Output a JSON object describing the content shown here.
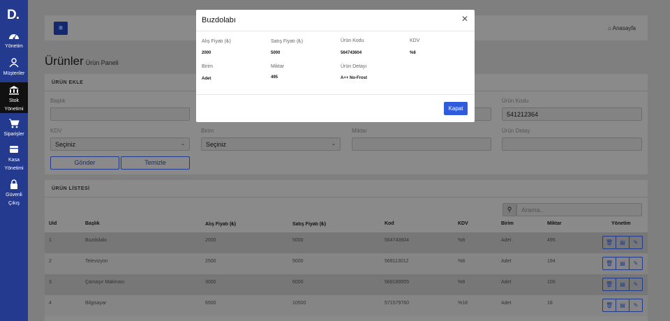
{
  "sidebar": {
    "logo": "D.",
    "items": [
      {
        "label_line1": "Yönetim",
        "label_line2": "",
        "icon": "dashboard-icon"
      },
      {
        "label_line1": "Müşteriler",
        "label_line2": "",
        "icon": "user-icon"
      },
      {
        "label_line1": "Stok",
        "label_line2": "Yönetimi",
        "icon": "bank-icon"
      },
      {
        "label_line1": "Siparişler",
        "label_line2": "",
        "icon": "cart-icon"
      },
      {
        "label_line1": "Kasa",
        "label_line2": "Yönetimi",
        "icon": "cash-register-icon"
      },
      {
        "label_line1": "Güvenli",
        "label_line2": "Çıkış",
        "icon": "lock-icon"
      }
    ]
  },
  "header": {
    "menu_icon": "≡",
    "home_label": "Anasayfa"
  },
  "page": {
    "title": "Ürünler",
    "subtitle": "Ürün Paneli"
  },
  "form": {
    "heading": "ÜRÜN EKLE",
    "baslik_label": "Başlık",
    "urun_kodu_label": "Ürün Kodu",
    "urun_kodu_value": "541212364",
    "kdv_label": "KDV",
    "kdv_value": "Seçiniz",
    "birim_label": "Birim",
    "birim_value": "Seçiniz",
    "miktar_label": "Miktar",
    "urun_detay_label": "Ürün Detay",
    "submit_label": "Gönder",
    "clear_label": "Temizle"
  },
  "list": {
    "heading": "ÜRÜN LİSTESİ",
    "search_placeholder": "Arama..",
    "columns": [
      "Uid",
      "Başlık",
      "Alış Fiyatı (₺)",
      "Satış Fiyatı (₺)",
      "Kod",
      "KDV",
      "Birim",
      "Miktar",
      "Yönetim"
    ],
    "rows": [
      {
        "uid": "1",
        "baslik": "Buzdolabı",
        "alis": "2000",
        "satis": "5000",
        "kod": "564743604",
        "kdv": "%8",
        "birim": "Adet",
        "miktar": "495"
      },
      {
        "uid": "2",
        "baslik": "Televizyon",
        "alis": "2500",
        "satis": "5000",
        "kod": "569113012",
        "kdv": "%8",
        "birim": "Adet",
        "miktar": "194"
      },
      {
        "uid": "3",
        "baslik": "Çamaşır Makinası",
        "alis": "3000",
        "satis": "6000",
        "kod": "569189555",
        "kdv": "%8",
        "birim": "Adet",
        "miktar": "100"
      },
      {
        "uid": "4",
        "baslik": "Bilgisayar",
        "alis": "6500",
        "satis": "10500",
        "kod": "571579760",
        "kdv": "%18",
        "birim": "Adet",
        "miktar": "18"
      }
    ]
  },
  "modal": {
    "title": "Buzdolabı",
    "alis_label": "Alış Fiyatı (₺)",
    "alis_value": "2000",
    "satis_label": "Satış Fiyatı (₺)",
    "satis_value": "5000",
    "kod_label": "Ürün Kodu",
    "kod_value": "564743604",
    "kdv_label": "KDV",
    "kdv_value": "%8",
    "birim_label": "Birim",
    "birim_value": "Adet",
    "miktar_label": "Miktar",
    "miktar_value": "495",
    "detay_label": "Ürün Detayı",
    "detay_value": "A++ No-Frost",
    "close_label": "Kapat"
  },
  "colors": {
    "sidebar": "#233a8e",
    "primary": "#2f5bdc",
    "overlay": "#7f7f7f"
  }
}
